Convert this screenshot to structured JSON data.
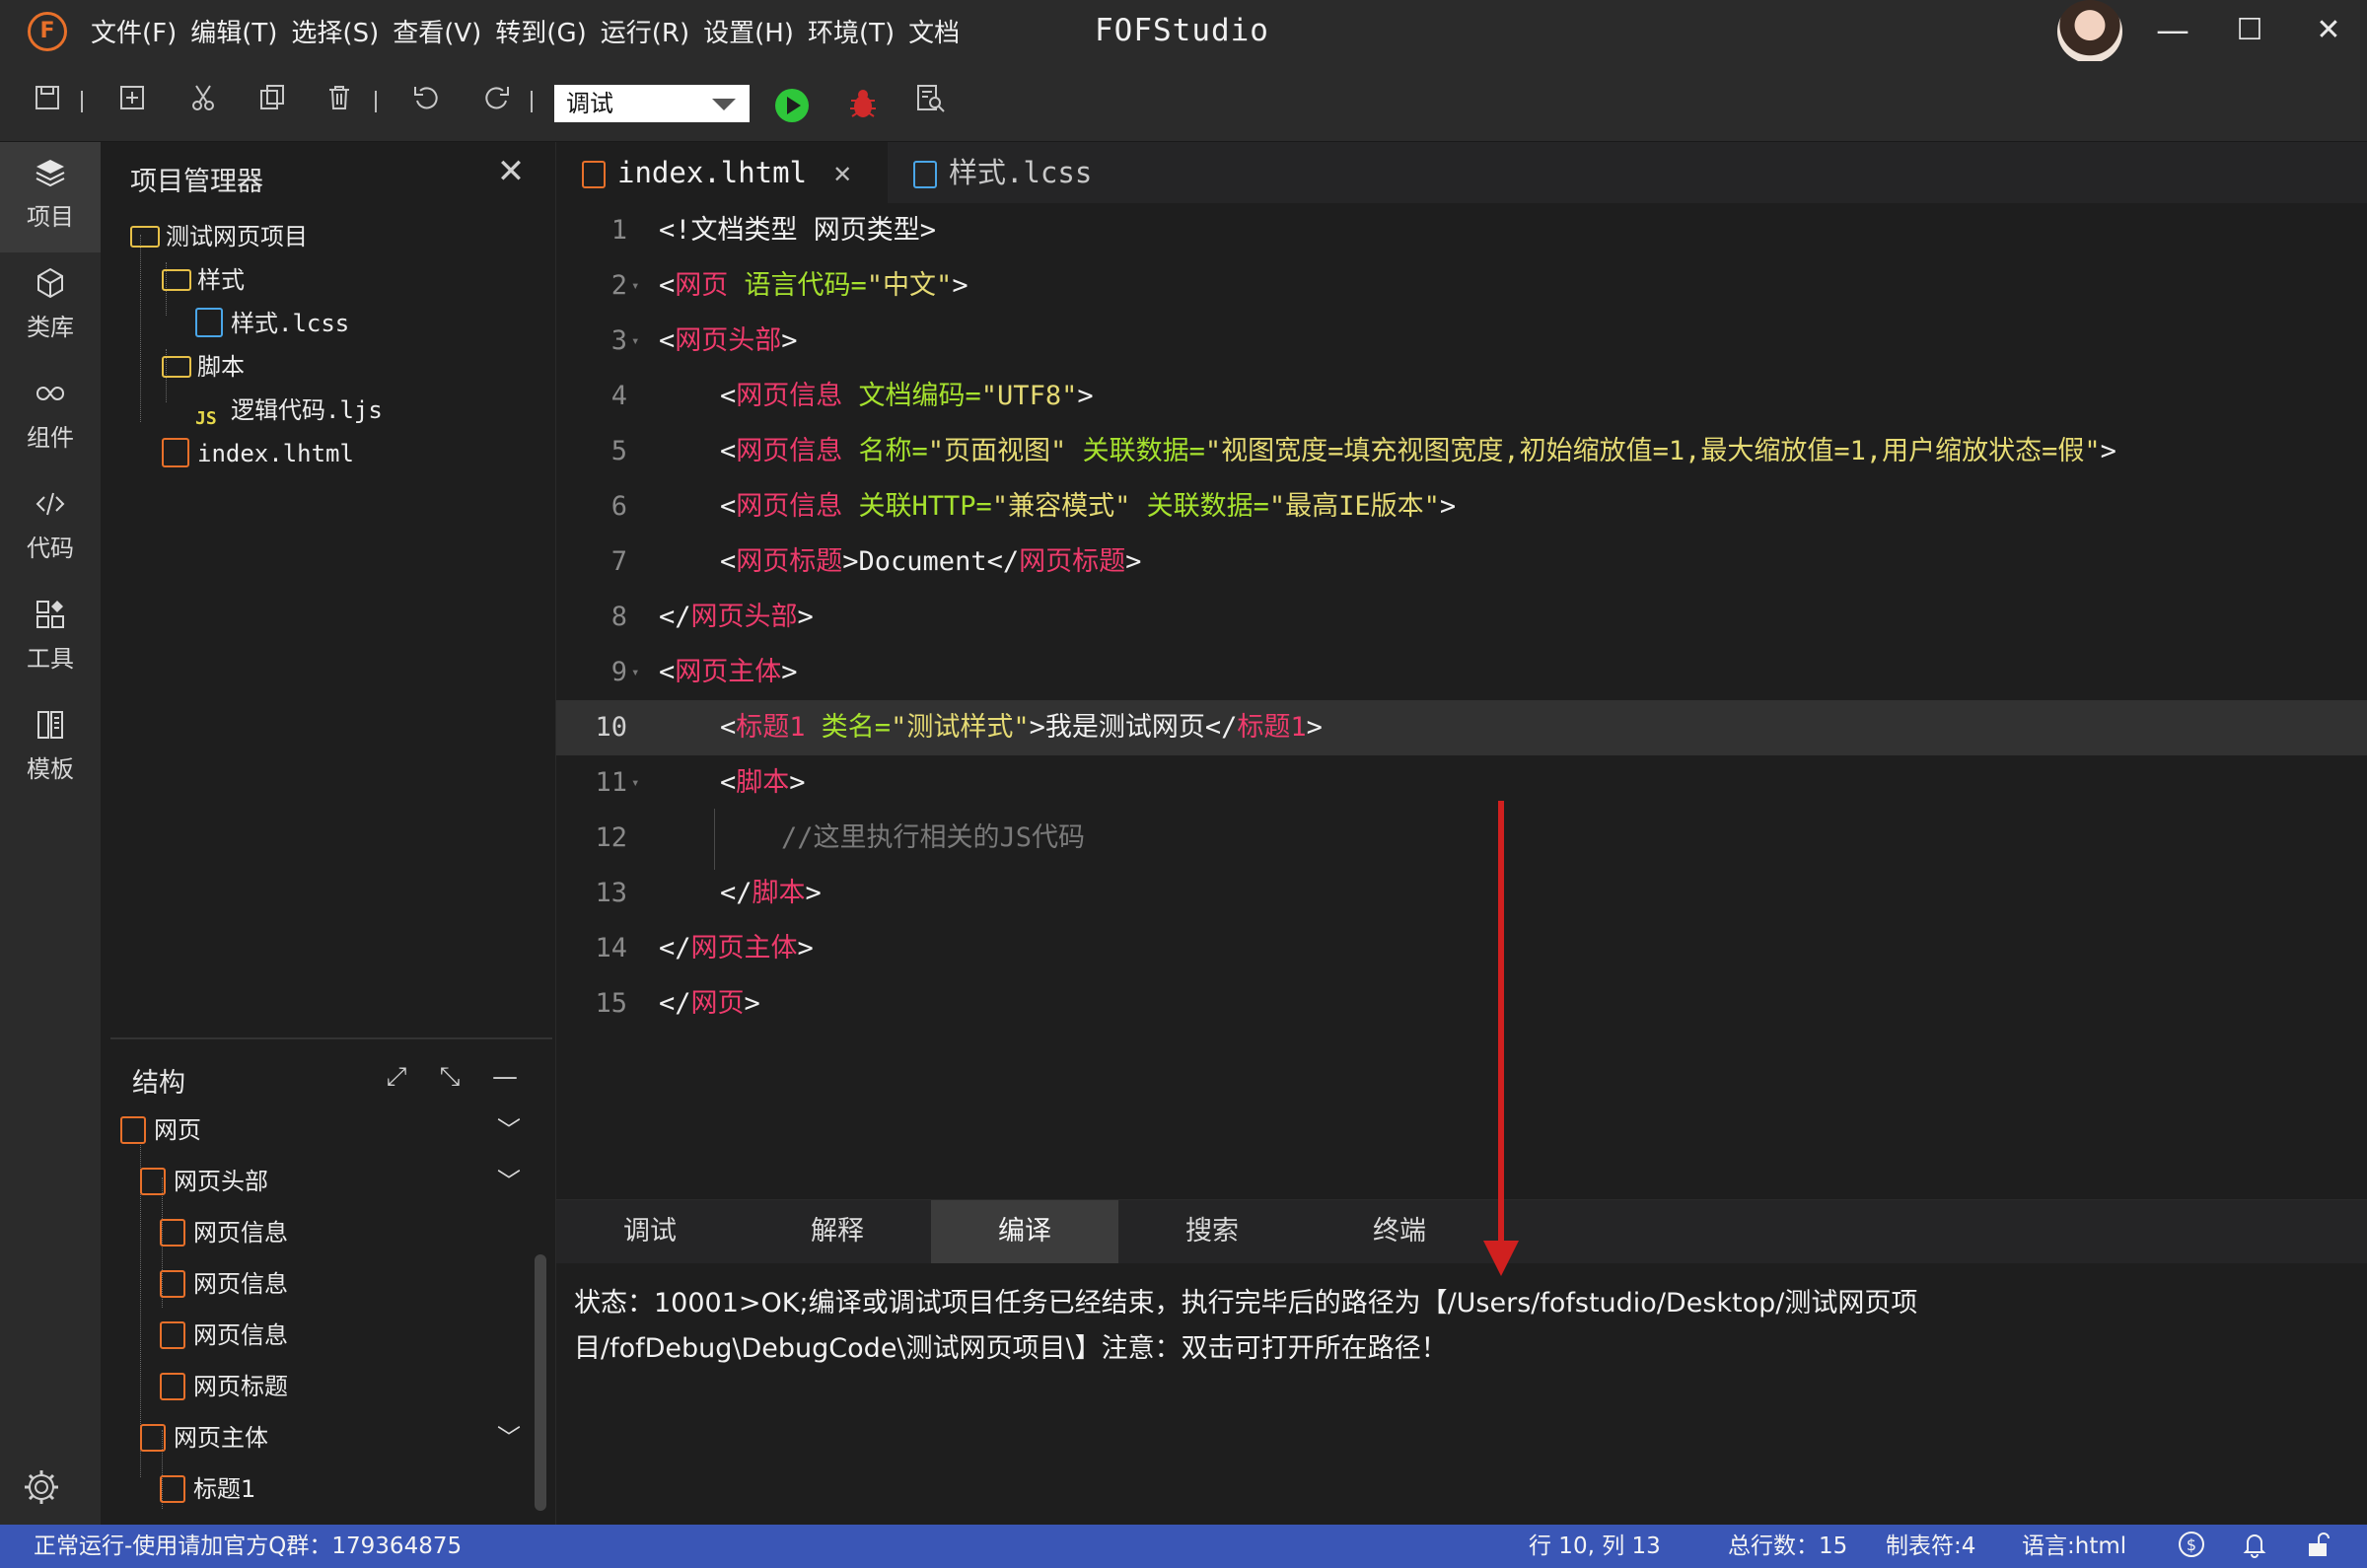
{
  "app": {
    "title": "FOFStudio",
    "logo_letter": "F",
    "menu": [
      "文件(F)",
      "编辑(T)",
      "选择(S)",
      "查看(V)",
      "转到(G)",
      "运行(R)",
      "设置(H)",
      "环境(T)",
      "文档"
    ],
    "window_controls": {
      "minimize": "—",
      "maximize": "☐",
      "close": "✕"
    }
  },
  "toolbar": {
    "mode_value": "调试",
    "icons": [
      "save-icon",
      "add-file-icon",
      "cut-icon",
      "copy-icon",
      "delete-icon",
      "undo-icon",
      "redo-icon",
      "run-icon",
      "debug-bug-icon",
      "search-file-icon"
    ]
  },
  "activity_bar": [
    {
      "label": "项目",
      "icon": "layers-icon",
      "active": true
    },
    {
      "label": "类库",
      "icon": "cube-icon",
      "active": false
    },
    {
      "label": "组件",
      "icon": "link-icon",
      "active": false
    },
    {
      "label": "代码",
      "icon": "code-icon",
      "active": false
    },
    {
      "label": "工具",
      "icon": "grid-icon",
      "active": false
    },
    {
      "label": "模板",
      "icon": "template-icon",
      "active": false
    }
  ],
  "explorer": {
    "title": "项目管理器",
    "close": "✕",
    "tree": [
      {
        "label": "测试网页项目",
        "type": "folder"
      },
      {
        "label": "样式",
        "type": "folder"
      },
      {
        "label": "样式.lcss",
        "type": "css"
      },
      {
        "label": "脚本",
        "type": "folder"
      },
      {
        "label": "逻辑代码.ljs",
        "type": "js",
        "badge": "JS"
      },
      {
        "label": "index.lhtml",
        "type": "html"
      }
    ]
  },
  "structure": {
    "title": "结构",
    "items": [
      "网页",
      "网页头部",
      "网页信息",
      "网页信息",
      "网页信息",
      "网页标题",
      "网页主体",
      "标题1"
    ]
  },
  "tabs": [
    {
      "label": "index.lhtml",
      "active": true,
      "close": "✕"
    },
    {
      "label": "样式.lcss",
      "active": false
    }
  ],
  "code": {
    "lines": [
      {
        "n": "1",
        "tokens": [
          [
            "p",
            "<!文档类型 网页类型>"
          ]
        ]
      },
      {
        "n": "2",
        "tokens": [
          [
            "p",
            "<"
          ],
          [
            "tag",
            "网页"
          ],
          [
            "p",
            " "
          ],
          [
            "attr",
            "语言代码="
          ],
          [
            "str",
            "\"中文\""
          ],
          [
            "p",
            ">"
          ]
        ]
      },
      {
        "n": "3",
        "tokens": [
          [
            "p",
            "<"
          ],
          [
            "tag",
            "网页头部"
          ],
          [
            "p",
            ">"
          ]
        ]
      },
      {
        "n": "4",
        "tokens": [
          [
            "p",
            "<"
          ],
          [
            "tag",
            "网页信息"
          ],
          [
            "p",
            " "
          ],
          [
            "attr",
            "文档编码="
          ],
          [
            "str",
            "\"UTF8\""
          ],
          [
            "p",
            ">"
          ]
        ]
      },
      {
        "n": "5",
        "tokens": [
          [
            "p",
            "<"
          ],
          [
            "tag",
            "网页信息"
          ],
          [
            "p",
            " "
          ],
          [
            "attr",
            "名称="
          ],
          [
            "str",
            "\"页面视图\""
          ],
          [
            "p",
            " "
          ],
          [
            "attr",
            "关联数据="
          ],
          [
            "str",
            "\"视图宽度=填充视图宽度,初始缩放值=1,最大缩放值=1,用户缩放状态=假\""
          ],
          [
            "p",
            ">"
          ]
        ]
      },
      {
        "n": "6",
        "tokens": [
          [
            "p",
            "<"
          ],
          [
            "tag",
            "网页信息"
          ],
          [
            "p",
            " "
          ],
          [
            "attr",
            "关联HTTP="
          ],
          [
            "str",
            "\"兼容模式\""
          ],
          [
            "p",
            " "
          ],
          [
            "attr",
            "关联数据="
          ],
          [
            "str",
            "\"最高IE版本\""
          ],
          [
            "p",
            ">"
          ]
        ]
      },
      {
        "n": "7",
        "tokens": [
          [
            "p",
            "<"
          ],
          [
            "tag",
            "网页标题"
          ],
          [
            "p",
            ">"
          ],
          [
            "txt",
            "Document"
          ],
          [
            "p",
            "</"
          ],
          [
            "tag",
            "网页标题"
          ],
          [
            "p",
            ">"
          ]
        ]
      },
      {
        "n": "8",
        "tokens": [
          [
            "p",
            "</"
          ],
          [
            "tag",
            "网页头部"
          ],
          [
            "p",
            ">"
          ]
        ]
      },
      {
        "n": "9",
        "tokens": [
          [
            "p",
            "<"
          ],
          [
            "tag",
            "网页主体"
          ],
          [
            "p",
            ">"
          ]
        ]
      },
      {
        "n": "10",
        "tokens": [
          [
            "p",
            "<"
          ],
          [
            "tag",
            "标题1"
          ],
          [
            "p",
            " "
          ],
          [
            "attr",
            "类名="
          ],
          [
            "str",
            "\"测试样式\""
          ],
          [
            "p",
            ">"
          ],
          [
            "txt",
            "我是测试网页"
          ],
          [
            "p",
            "</"
          ],
          [
            "tag",
            "标题1"
          ],
          [
            "p",
            ">"
          ]
        ]
      },
      {
        "n": "11",
        "tokens": [
          [
            "p",
            "<"
          ],
          [
            "tag",
            "脚本"
          ],
          [
            "p",
            ">"
          ]
        ]
      },
      {
        "n": "12",
        "tokens": [
          [
            "cmt",
            "//这里执行相关的JS代码"
          ]
        ]
      },
      {
        "n": "13",
        "tokens": [
          [
            "p",
            "</"
          ],
          [
            "tag",
            "脚本"
          ],
          [
            "p",
            ">"
          ]
        ]
      },
      {
        "n": "14",
        "tokens": [
          [
            "p",
            "</"
          ],
          [
            "tag",
            "网页主体"
          ],
          [
            "p",
            ">"
          ]
        ]
      },
      {
        "n": "15",
        "tokens": [
          [
            "p",
            "</"
          ],
          [
            "tag",
            "网页"
          ],
          [
            "p",
            ">"
          ]
        ]
      }
    ],
    "current_line": "10"
  },
  "panel": {
    "tabs": [
      "调试",
      "解释",
      "编译",
      "搜索",
      "终端"
    ],
    "active_tab": "编译",
    "output_line1": "状态：10001>OK;编译或调试项目任务已经结束，执行完毕后的路径为【/Users/fofstudio/Desktop/测试网页项",
    "output_line2": "目/fofDebug\\DebugCode\\测试网页项目\\】注意：双击可打开所在路径！"
  },
  "statusbar": {
    "left": "正常运行-使用请加官方Q群：179364875",
    "position": "行 10, 列 13",
    "total_lines": "总行数：15",
    "tab_size": "制表符:4",
    "language": "语言:html",
    "icons": [
      "dollar-icon",
      "bell-icon",
      "unlock-icon"
    ]
  },
  "colors": {
    "accent_status": "#3a56b6",
    "tag": "#ee3b6c",
    "attr": "#a6e22e",
    "string": "#e6db74",
    "arrow": "#d0201f"
  }
}
